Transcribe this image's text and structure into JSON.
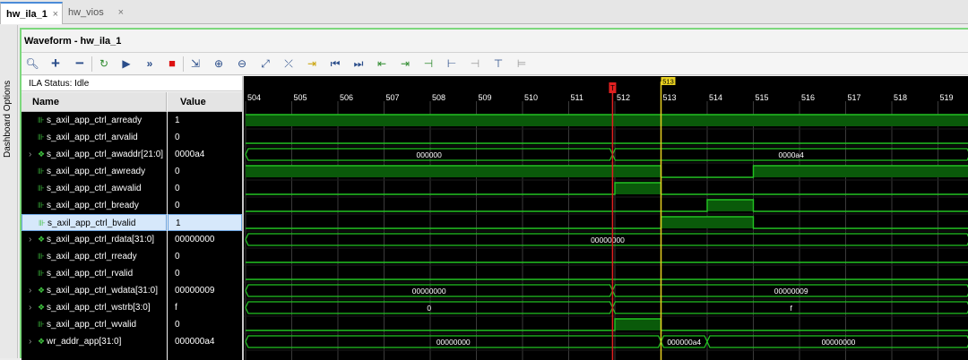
{
  "tabs": [
    {
      "label": "hw_ila_1",
      "close": "×"
    },
    {
      "label": "hw_vios",
      "close": "×"
    }
  ],
  "side_label": "Dashboard Options",
  "panel_title": "Waveform - hw_ila_1",
  "toolbar_icons": [
    "search-icon",
    "add-icon",
    "remove-icon",
    "refresh-icon",
    "run-trigger-icon",
    "run-immediate-icon",
    "stop-icon",
    "export-icon",
    "zoom-in-icon",
    "zoom-out-icon",
    "zoom-fit-icon",
    "cursor-icon",
    "marker-icon",
    "go-first-icon",
    "go-last-icon",
    "prev-transition-icon",
    "next-transition-icon",
    "add-marker-icon",
    "prev-marker-icon",
    "next-marker-icon",
    "swap-cursor-icon",
    "ruler-icon"
  ],
  "ila_status": "ILA Status:  Idle",
  "columns": {
    "name": "Name",
    "value": "Value"
  },
  "signals": [
    {
      "name": "s_axil_app_ctrl_arready",
      "value": "1",
      "bus": false
    },
    {
      "name": "s_axil_app_ctrl_arvalid",
      "value": "0",
      "bus": false
    },
    {
      "name": "s_axil_app_ctrl_awaddr[21:0]",
      "value": "0000a4",
      "bus": true
    },
    {
      "name": "s_axil_app_ctrl_awready",
      "value": "0",
      "bus": false
    },
    {
      "name": "s_axil_app_ctrl_awvalid",
      "value": "0",
      "bus": false
    },
    {
      "name": "s_axil_app_ctrl_bready",
      "value": "0",
      "bus": false
    },
    {
      "name": "s_axil_app_ctrl_bvalid",
      "value": "1",
      "bus": false,
      "selected": true
    },
    {
      "name": "s_axil_app_ctrl_rdata[31:0]",
      "value": "00000000",
      "bus": true
    },
    {
      "name": "s_axil_app_ctrl_rready",
      "value": "0",
      "bus": false
    },
    {
      "name": "s_axil_app_ctrl_rvalid",
      "value": "0",
      "bus": false
    },
    {
      "name": "s_axil_app_ctrl_wdata[31:0]",
      "value": "00000009",
      "bus": true
    },
    {
      "name": "s_axil_app_ctrl_wstrb[3:0]",
      "value": "f",
      "bus": true
    },
    {
      "name": "s_axil_app_ctrl_wvalid",
      "value": "0",
      "bus": false
    },
    {
      "name": "wr_addr_app[31:0]",
      "value": "000000a4",
      "bus": true
    }
  ],
  "timeline": {
    "start": 504,
    "end": 519,
    "ticks": [
      "504",
      "505",
      "506",
      "507",
      "508",
      "509",
      "510",
      "511",
      "512",
      "513",
      "514",
      "515",
      "516",
      "517",
      "518",
      "519"
    ],
    "trigger_marker": {
      "label": "T",
      "sample": 511.95,
      "color": "#e02020"
    },
    "cursor_marker": {
      "label": "513",
      "sample": 513,
      "color": "#e8d020"
    }
  },
  "waveforms": [
    {
      "type": "bit",
      "segs": [
        [
          504,
          520,
          1
        ]
      ]
    },
    {
      "type": "bit",
      "segs": [
        [
          504,
          520,
          0
        ]
      ]
    },
    {
      "type": "bus",
      "segs": [
        [
          504,
          511.95,
          "000000"
        ],
        [
          511.95,
          520,
          "0000a4"
        ]
      ]
    },
    {
      "type": "bit",
      "segs": [
        [
          504,
          513,
          1
        ],
        [
          513,
          515,
          0
        ],
        [
          515,
          520,
          1
        ]
      ]
    },
    {
      "type": "bit",
      "segs": [
        [
          504,
          512,
          0
        ],
        [
          512,
          513,
          1
        ],
        [
          513,
          520,
          0
        ]
      ]
    },
    {
      "type": "bit",
      "segs": [
        [
          504,
          514,
          0
        ],
        [
          514,
          515,
          1
        ],
        [
          515,
          520,
          0
        ]
      ]
    },
    {
      "type": "bit",
      "segs": [
        [
          504,
          513,
          0
        ],
        [
          513,
          515,
          1
        ],
        [
          515,
          520,
          0
        ]
      ]
    },
    {
      "type": "bus",
      "segs": [
        [
          504,
          520,
          "00000000"
        ]
      ]
    },
    {
      "type": "bit",
      "segs": [
        [
          504,
          520,
          0
        ]
      ]
    },
    {
      "type": "bit",
      "segs": [
        [
          504,
          520,
          0
        ]
      ]
    },
    {
      "type": "bus",
      "segs": [
        [
          504,
          511.95,
          "00000000"
        ],
        [
          511.95,
          520,
          "00000009"
        ]
      ]
    },
    {
      "type": "bus",
      "segs": [
        [
          504,
          511.95,
          "0"
        ],
        [
          511.95,
          520,
          "f"
        ]
      ]
    },
    {
      "type": "bit",
      "segs": [
        [
          504,
          512,
          0
        ],
        [
          512,
          513,
          1
        ],
        [
          513,
          520,
          0
        ]
      ]
    },
    {
      "type": "bus",
      "segs": [
        [
          504,
          513,
          "00000000"
        ],
        [
          513,
          514,
          "000000a4"
        ],
        [
          514,
          520,
          "00000000"
        ]
      ]
    }
  ],
  "colors": {
    "wave": "#22c322",
    "wave_fill": "#0a5a0a",
    "grid": "#3a3a3a",
    "bus_text": "#ffffff"
  }
}
